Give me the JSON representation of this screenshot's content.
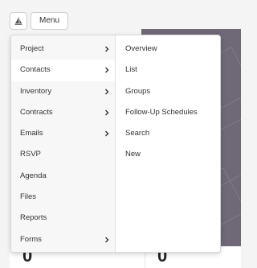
{
  "toolbar": {
    "logo_icon": "sailboat-logo-icon",
    "menu_label": "Menu"
  },
  "menu": {
    "items": [
      {
        "label": "Project",
        "has_submenu": true
      },
      {
        "label": "Contacts",
        "has_submenu": true,
        "active": true
      },
      {
        "label": "Inventory",
        "has_submenu": true
      },
      {
        "label": "Contracts",
        "has_submenu": true
      },
      {
        "label": "Emails",
        "has_submenu": true
      },
      {
        "label": "RSVP",
        "has_submenu": false
      },
      {
        "label": "Agenda",
        "has_submenu": false
      },
      {
        "label": "Files",
        "has_submenu": false
      },
      {
        "label": "Reports",
        "has_submenu": false
      },
      {
        "label": "Forms",
        "has_submenu": true
      }
    ],
    "submenu": [
      {
        "label": "Overview"
      },
      {
        "label": "List"
      },
      {
        "label": "Groups"
      },
      {
        "label": "Follow-Up Schedules"
      },
      {
        "label": "Search"
      },
      {
        "label": "New"
      }
    ],
    "chevron_icon": "chevron-right-icon"
  },
  "background": {
    "left_value": "0",
    "right_value": "0",
    "hero_color": "#6f6877"
  }
}
